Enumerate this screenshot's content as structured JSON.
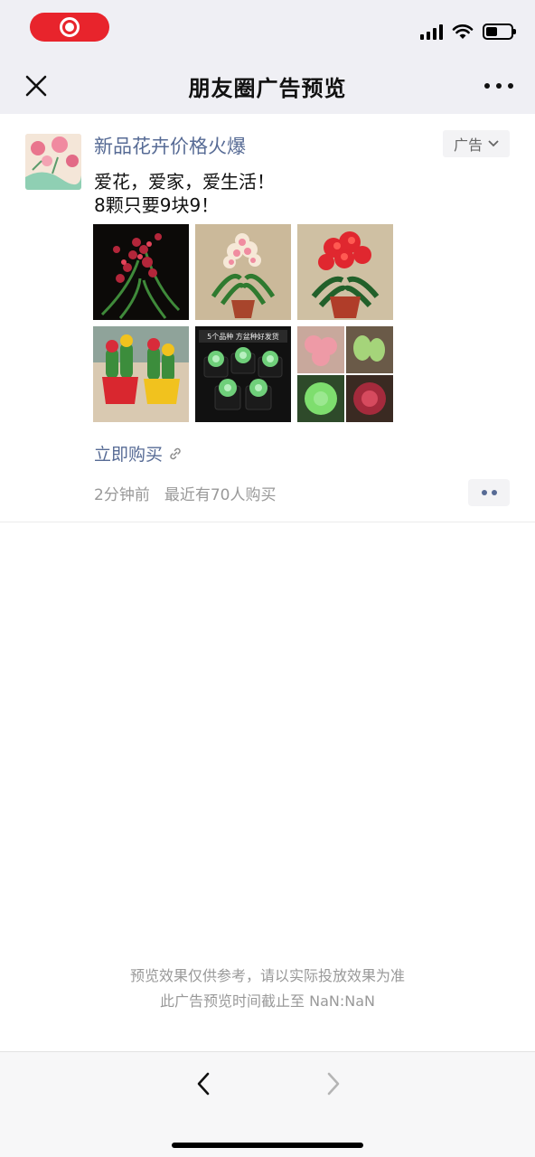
{
  "status_bar": {
    "recording": true
  },
  "nav": {
    "title": "朋友圈广告预览",
    "close_icon": "close-icon",
    "more_icon": "more-dots-icon"
  },
  "post": {
    "author": "新品花卉价格火爆",
    "ad_tag": "广告",
    "text_line1": "爱花，爱家，爱生活！",
    "text_line2": "8颗只要9块9！",
    "images": [
      {
        "name": "red-orchid-photo"
      },
      {
        "name": "pink-clivia-photo"
      },
      {
        "name": "red-clivia-photo"
      },
      {
        "name": "cactus-pots-photo"
      },
      {
        "name": "succulents-five-varieties-photo",
        "banner": "5个品种 方盆种好发货"
      },
      {
        "name": "succulent-collage-photo"
      }
    ],
    "buy_link": "立即购买",
    "time": "2分钟前",
    "buyers": "最近有70人购买"
  },
  "notice": {
    "line1": "预览效果仅供参考，请以实际投放效果为准",
    "line2": "此广告预览时间截止至 NaN:NaN"
  },
  "colors": {
    "link": "#576b95",
    "nav_bg": "#efeff4",
    "record": "#e8242c"
  }
}
